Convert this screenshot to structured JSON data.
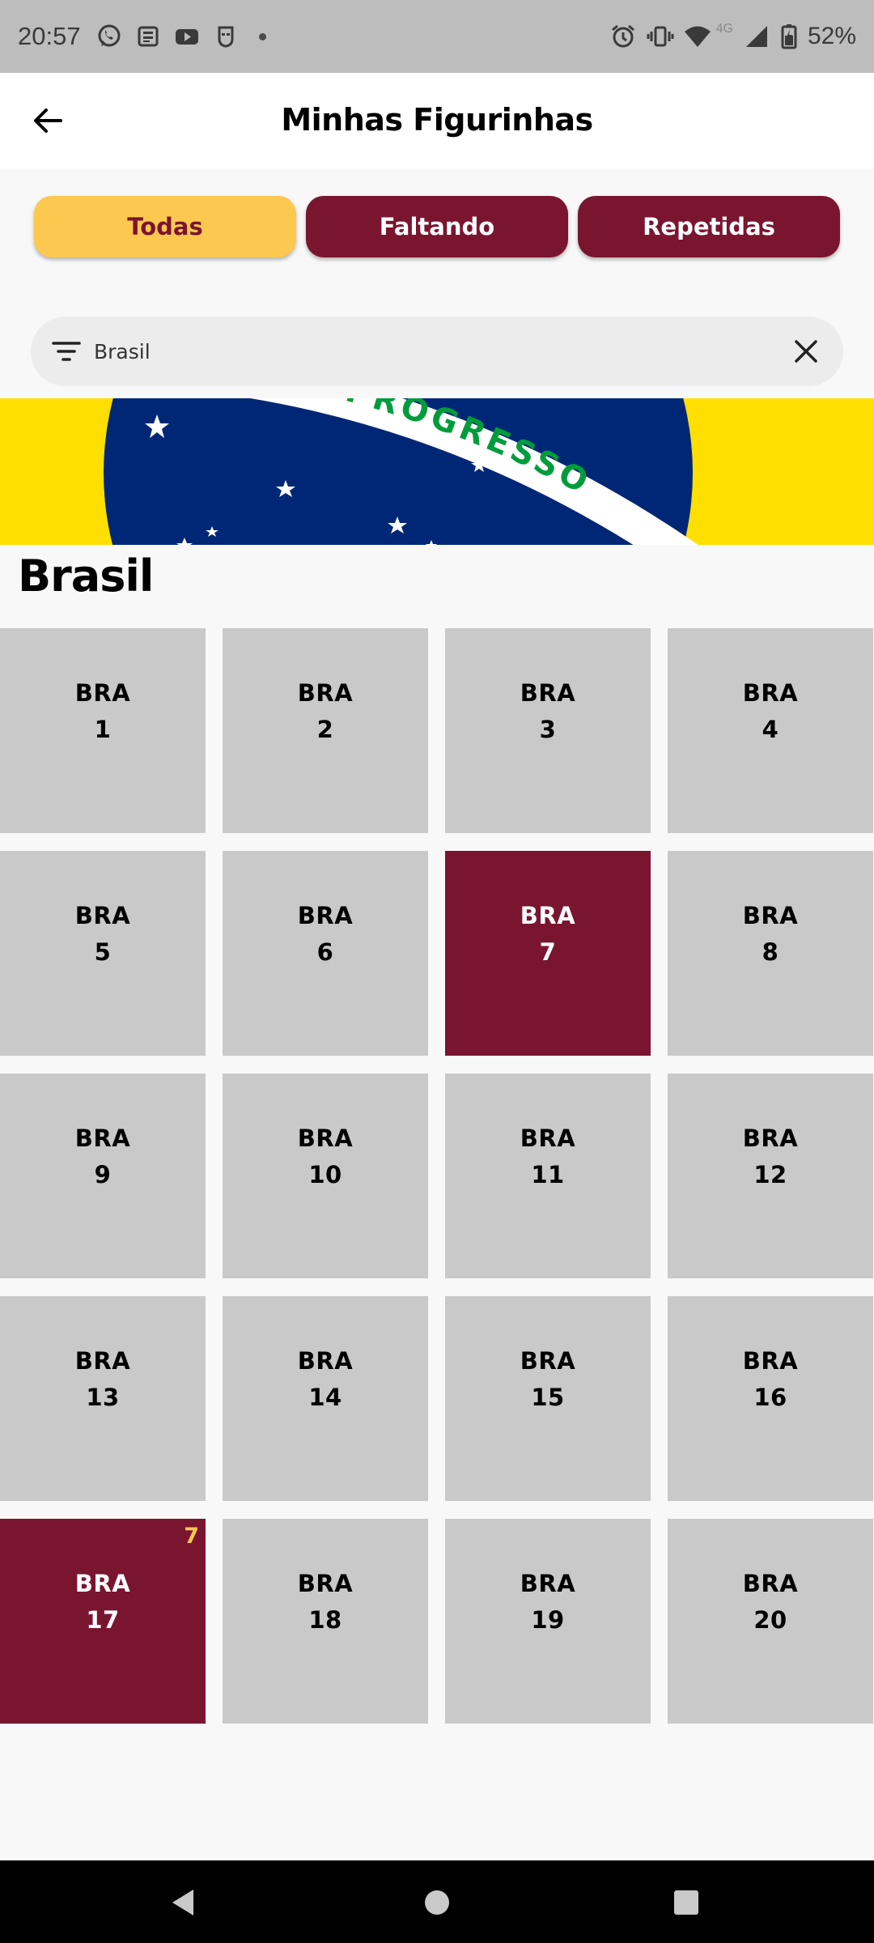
{
  "status_bar": {
    "time": "20:57",
    "network_label": "4G",
    "battery": "52%",
    "left_icons": [
      "whatsapp-icon",
      "news-icon",
      "youtube-icon",
      "mask-app-icon"
    ],
    "right_icons": [
      "alarm-icon",
      "vibrate-icon",
      "wifi-icon",
      "signal-icon",
      "battery-icon"
    ]
  },
  "app_bar": {
    "title": "Minhas Figurinhas",
    "back_icon": "arrow-left-icon"
  },
  "tabs": [
    {
      "label": "Todas",
      "active": true
    },
    {
      "label": "Faltando",
      "active": false
    },
    {
      "label": "Repetidas",
      "active": false
    }
  ],
  "search": {
    "value": "Brasil",
    "filter_icon": "filter-icon",
    "clear_icon": "close-icon"
  },
  "banner": {
    "motto": "PROGRESSO",
    "colors": {
      "green": "#009c3b",
      "yellow": "#ffdf00",
      "blue": "#002776",
      "white": "#ffffff"
    }
  },
  "section": {
    "title": "Brasil"
  },
  "stickers": [
    {
      "code": "BRA",
      "number": "1",
      "owned": false,
      "badge": ""
    },
    {
      "code": "BRA",
      "number": "2",
      "owned": false,
      "badge": ""
    },
    {
      "code": "BRA",
      "number": "3",
      "owned": false,
      "badge": ""
    },
    {
      "code": "BRA",
      "number": "4",
      "owned": false,
      "badge": ""
    },
    {
      "code": "BRA",
      "number": "5",
      "owned": false,
      "badge": ""
    },
    {
      "code": "BRA",
      "number": "6",
      "owned": false,
      "badge": ""
    },
    {
      "code": "BRA",
      "number": "7",
      "owned": true,
      "badge": ""
    },
    {
      "code": "BRA",
      "number": "8",
      "owned": false,
      "badge": ""
    },
    {
      "code": "BRA",
      "number": "9",
      "owned": false,
      "badge": ""
    },
    {
      "code": "BRA",
      "number": "10",
      "owned": false,
      "badge": ""
    },
    {
      "code": "BRA",
      "number": "11",
      "owned": false,
      "badge": ""
    },
    {
      "code": "BRA",
      "number": "12",
      "owned": false,
      "badge": ""
    },
    {
      "code": "BRA",
      "number": "13",
      "owned": false,
      "badge": ""
    },
    {
      "code": "BRA",
      "number": "14",
      "owned": false,
      "badge": ""
    },
    {
      "code": "BRA",
      "number": "15",
      "owned": false,
      "badge": ""
    },
    {
      "code": "BRA",
      "number": "16",
      "owned": false,
      "badge": ""
    },
    {
      "code": "BRA",
      "number": "17",
      "owned": true,
      "badge": "7"
    },
    {
      "code": "BRA",
      "number": "18",
      "owned": false,
      "badge": ""
    },
    {
      "code": "BRA",
      "number": "19",
      "owned": false,
      "badge": ""
    },
    {
      "code": "BRA",
      "number": "20",
      "owned": false,
      "badge": ""
    }
  ],
  "colors": {
    "accent_yellow": "#fdc84f",
    "accent_maroon": "#7a1530",
    "sticker_missing": "#c9c9c9"
  },
  "nav_bar": {
    "icons": [
      "nav-back-icon",
      "nav-home-icon",
      "nav-recents-icon"
    ]
  }
}
